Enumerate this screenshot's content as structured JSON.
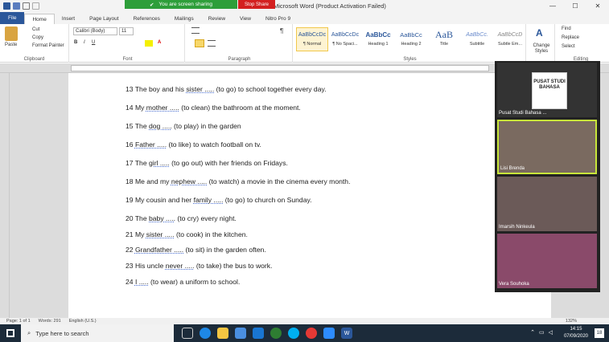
{
  "window": {
    "title": "Microsoft Word (Product Activation Failed)",
    "sharing_text": "You are screen sharing",
    "stop_share": "Stop Share",
    "minimize": "—",
    "maximize": "☐",
    "close": "✕"
  },
  "tabs": [
    "File",
    "Home",
    "Insert",
    "Page Layout",
    "References",
    "Mailings",
    "Review",
    "View",
    "Nitro Pro 9"
  ],
  "ribbon": {
    "clipboard": {
      "label": "Clipboard",
      "paste": "Paste",
      "cut": "Cut",
      "copy": "Copy",
      "format_painter": "Format Painter"
    },
    "font": {
      "label": "Font",
      "family": "Calibri (Body)",
      "size": "11"
    },
    "paragraph": {
      "label": "Paragraph"
    },
    "styles": {
      "label": "Styles",
      "items": [
        {
          "preview": "AaBbCcDc",
          "name": "¶ Normal"
        },
        {
          "preview": "AaBbCcDc",
          "name": "¶ No Spaci..."
        },
        {
          "preview": "AaBbCc",
          "name": "Heading 1"
        },
        {
          "preview": "AaBbCc",
          "name": "Heading 2"
        },
        {
          "preview": "AaB",
          "name": "Title"
        },
        {
          "preview": "AaBbCc.",
          "name": "Subtitle"
        },
        {
          "preview": "AaBbCcD",
          "name": "Subtle Em..."
        }
      ],
      "change": "Change Styles"
    },
    "editing": {
      "label": "Editing",
      "find": "Find",
      "replace": "Replace",
      "select": "Select"
    }
  },
  "document": {
    "lines": [
      {
        "num": "13",
        "pre": "The boy and his ",
        "u": "sister .....",
        "post": " (to go) to school together every day."
      },
      {
        "num": "14",
        "pre": "My ",
        "u": "mother .....",
        "post": " (to clean) the bathroom at the moment."
      },
      {
        "num": "15",
        "pre": "The ",
        "u": "dog .....",
        "post": " (to play) in the garden"
      },
      {
        "num": "16",
        "pre": "",
        "u": "Father .....",
        "post": " (to like) to watch football on tv."
      },
      {
        "num": "17",
        "pre": "The ",
        "u": "girl .....",
        "post": " (to go out) with her friends on Fridays."
      },
      {
        "num": "18",
        "pre": "Me and my ",
        "u": "nephew .....",
        "post": " (to watch) a movie in the cinema every month."
      },
      {
        "num": "19",
        "pre": "My cousin and her ",
        "u": "family .....",
        "post": " (to go) to church on Sunday."
      },
      {
        "num": "20",
        "pre": "The ",
        "u": "baby .....",
        "post": " (to cry) every night."
      },
      {
        "num": "21",
        "pre": "My ",
        "u": "sister .....",
        "post": " (to cook) in the kitchen."
      },
      {
        "num": "22",
        "pre": "",
        "u": "Grandfather .....",
        "post": " (to sit) in the garden often."
      },
      {
        "num": "23",
        "pre": "His uncle ",
        "u": "never .....",
        "post": " (to take) the bus to work."
      },
      {
        "num": "24",
        "pre": "",
        "u": "I .....",
        "post": " (to wear) a uniform to school."
      }
    ]
  },
  "status": {
    "page": "Page: 1 of 1",
    "words": "Words: 291",
    "language": "English (U.S.)",
    "zoom": "132%"
  },
  "video": {
    "participants": [
      {
        "name": "Pusat Studi Bahasa ...",
        "logo": "PUSAT STUDI BAHASA"
      },
      {
        "name": "Lisi Brenda"
      },
      {
        "name": "Imarsih Ninkeula"
      },
      {
        "name": "Vera Souhoka"
      }
    ]
  },
  "taskbar": {
    "search_placeholder": "Type here to search",
    "time": "14:15",
    "date": "07/09/2020",
    "notifications": "18"
  },
  "colors": {
    "file_tab": "#2b579a",
    "share_green": "#2e9e3a",
    "stop_red": "#d32020",
    "taskbar": "#1c2b3a"
  }
}
